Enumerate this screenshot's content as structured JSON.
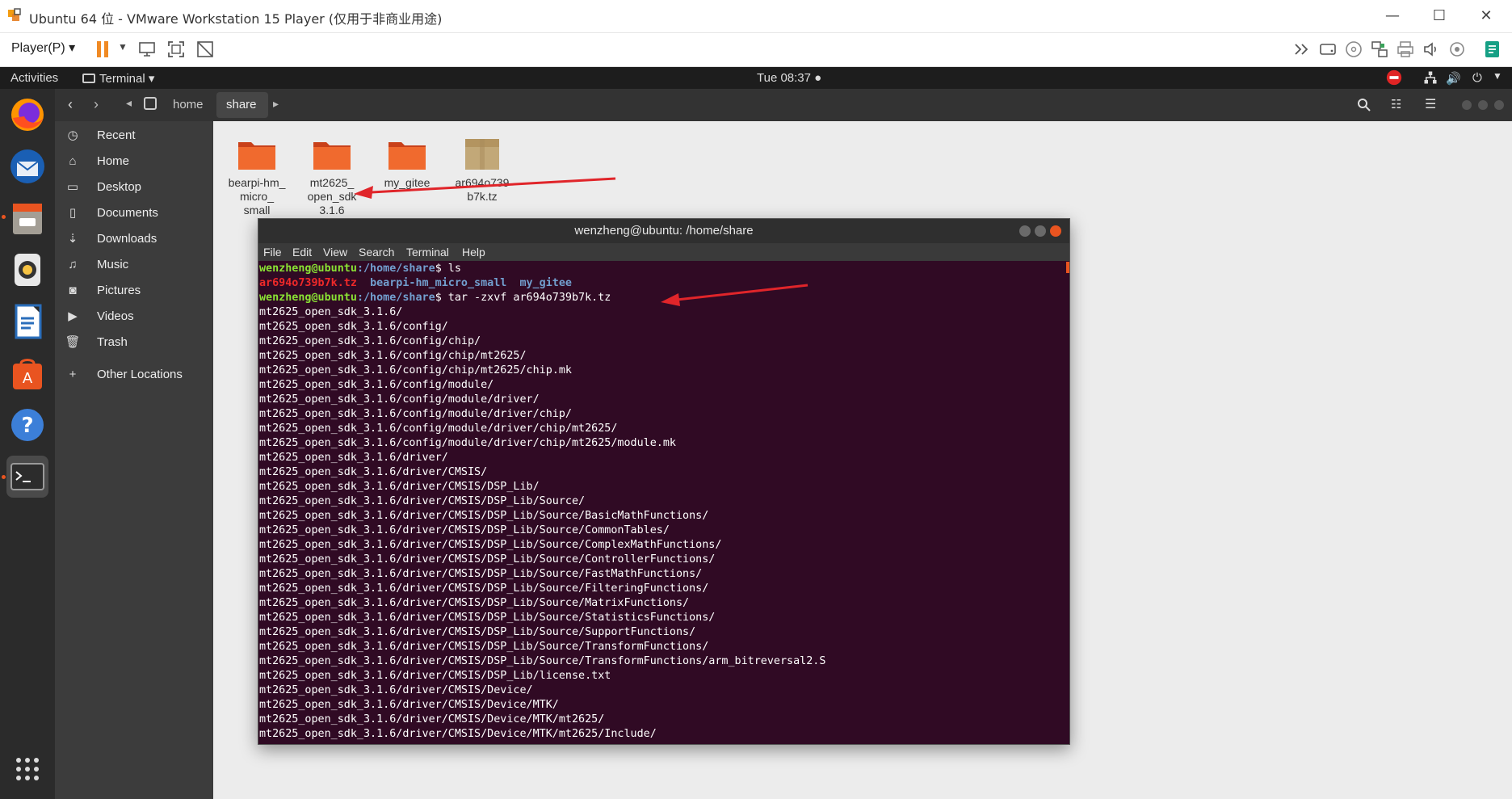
{
  "vm": {
    "title": "Ubuntu 64 位 - VMware Workstation 15 Player (仅用于非商业用途)",
    "player_menu": "Player(P)",
    "window_controls": {
      "minimize": "—",
      "maximize": "☐",
      "close": "✕"
    }
  },
  "ubuntu_topbar": {
    "activities": "Activities",
    "app_menu": "Terminal ▾",
    "clock": "Tue 08:37 ●"
  },
  "files": {
    "breadcrumb": [
      "home",
      "share"
    ],
    "sidebar": [
      {
        "label": "Recent",
        "icon": "clock-icon"
      },
      {
        "label": "Home",
        "icon": "home-icon"
      },
      {
        "label": "Desktop",
        "icon": "folder-icon"
      },
      {
        "label": "Documents",
        "icon": "document-icon"
      },
      {
        "label": "Downloads",
        "icon": "download-icon"
      },
      {
        "label": "Music",
        "icon": "music-icon"
      },
      {
        "label": "Pictures",
        "icon": "camera-icon"
      },
      {
        "label": "Videos",
        "icon": "video-icon"
      },
      {
        "label": "Trash",
        "icon": "trash-icon"
      },
      {
        "label": "Other Locations",
        "icon": "plus-icon"
      }
    ],
    "items": [
      {
        "label_lines": [
          "bearpi-hm_",
          "micro_",
          "small"
        ],
        "type": "folder"
      },
      {
        "label_lines": [
          "mt2625_",
          "open_sdk",
          "3.1.6"
        ],
        "type": "folder"
      },
      {
        "label_lines": [
          "my_gitee"
        ],
        "type": "folder"
      },
      {
        "label_lines": [
          "ar694o739",
          "b7k.tz"
        ],
        "type": "archive"
      }
    ]
  },
  "terminal": {
    "title": "wenzheng@ubuntu: /home/share",
    "menu": [
      "File",
      "Edit",
      "View",
      "Search",
      "Terminal",
      "Help"
    ],
    "prompt_user": "wenzheng@ubuntu",
    "prompt_path": ":/home/share",
    "cmd1": "$ ls",
    "ls_archive": "ar694o739b7k.tz",
    "ls_dir1": "bearpi-hm_micro_small",
    "ls_dir2": "my_gitee",
    "cmd2": "$ tar -zxvf ar694o739b7k.tz",
    "output": [
      "mt2625_open_sdk_3.1.6/",
      "mt2625_open_sdk_3.1.6/config/",
      "mt2625_open_sdk_3.1.6/config/chip/",
      "mt2625_open_sdk_3.1.6/config/chip/mt2625/",
      "mt2625_open_sdk_3.1.6/config/chip/mt2625/chip.mk",
      "mt2625_open_sdk_3.1.6/config/module/",
      "mt2625_open_sdk_3.1.6/config/module/driver/",
      "mt2625_open_sdk_3.1.6/config/module/driver/chip/",
      "mt2625_open_sdk_3.1.6/config/module/driver/chip/mt2625/",
      "mt2625_open_sdk_3.1.6/config/module/driver/chip/mt2625/module.mk",
      "mt2625_open_sdk_3.1.6/driver/",
      "mt2625_open_sdk_3.1.6/driver/CMSIS/",
      "mt2625_open_sdk_3.1.6/driver/CMSIS/DSP_Lib/",
      "mt2625_open_sdk_3.1.6/driver/CMSIS/DSP_Lib/Source/",
      "mt2625_open_sdk_3.1.6/driver/CMSIS/DSP_Lib/Source/BasicMathFunctions/",
      "mt2625_open_sdk_3.1.6/driver/CMSIS/DSP_Lib/Source/CommonTables/",
      "mt2625_open_sdk_3.1.6/driver/CMSIS/DSP_Lib/Source/ComplexMathFunctions/",
      "mt2625_open_sdk_3.1.6/driver/CMSIS/DSP_Lib/Source/ControllerFunctions/",
      "mt2625_open_sdk_3.1.6/driver/CMSIS/DSP_Lib/Source/FastMathFunctions/",
      "mt2625_open_sdk_3.1.6/driver/CMSIS/DSP_Lib/Source/FilteringFunctions/",
      "mt2625_open_sdk_3.1.6/driver/CMSIS/DSP_Lib/Source/MatrixFunctions/",
      "mt2625_open_sdk_3.1.6/driver/CMSIS/DSP_Lib/Source/StatisticsFunctions/",
      "mt2625_open_sdk_3.1.6/driver/CMSIS/DSP_Lib/Source/SupportFunctions/",
      "mt2625_open_sdk_3.1.6/driver/CMSIS/DSP_Lib/Source/TransformFunctions/",
      "mt2625_open_sdk_3.1.6/driver/CMSIS/DSP_Lib/Source/TransformFunctions/arm_bitreversal2.S",
      "mt2625_open_sdk_3.1.6/driver/CMSIS/DSP_Lib/license.txt",
      "mt2625_open_sdk_3.1.6/driver/CMSIS/Device/",
      "mt2625_open_sdk_3.1.6/driver/CMSIS/Device/MTK/",
      "mt2625_open_sdk_3.1.6/driver/CMSIS/Device/MTK/mt2625/",
      "mt2625_open_sdk_3.1.6/driver/CMSIS/Device/MTK/mt2625/Include/"
    ]
  },
  "colors": {
    "terminal_bg": "#300a24",
    "prompt_user": "#8ae234",
    "prompt_path": "#729fcf",
    "archive": "#ef2929",
    "annotation_arrow": "#e0252a",
    "folder": "#e95420"
  }
}
